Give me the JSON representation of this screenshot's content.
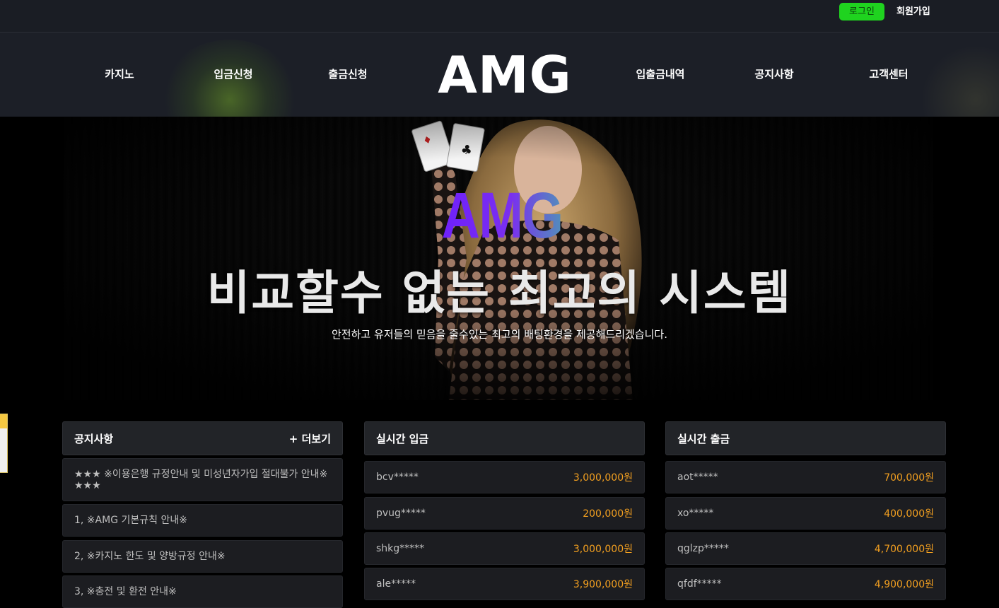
{
  "topbar": {
    "login_label": "로그인",
    "signup_label": "회원가입"
  },
  "nav": {
    "logo": "AMG",
    "items": [
      "카지노",
      "입금신청",
      "출금신청",
      "입출금내역",
      "공지사항",
      "고객센터"
    ]
  },
  "hero": {
    "logo": "AMG",
    "title": "비교할수 없는 최고의 시스템",
    "subtitle": "안전하고 유저들의 믿음을 줄수있는 최고의 배팅환경을 제공해드리겠습니다."
  },
  "notice": {
    "title": "공지사항",
    "more": "+ 더보기",
    "items": [
      "★★★ ※이용은행 규정안내 및 미성년자가입 절대불가 안내※ ★★★",
      "1, ※AMG 기본규칙 안내※",
      "2, ※카지노 한도 및 양방규정 안내※",
      "3, ※충전 및 환전 안내※"
    ]
  },
  "deposit": {
    "title": "실시간 입금",
    "rows": [
      {
        "user": "bcv*****",
        "amount": "3,000,000원"
      },
      {
        "user": "pvug*****",
        "amount": "200,000원"
      },
      {
        "user": "shkg*****",
        "amount": "3,000,000원"
      },
      {
        "user": "ale*****",
        "amount": "3,900,000원"
      }
    ]
  },
  "withdraw": {
    "title": "실시간 출금",
    "rows": [
      {
        "user": "aot*****",
        "amount": "700,000원"
      },
      {
        "user": "xo*****",
        "amount": "400,000원"
      },
      {
        "user": "qglzp*****",
        "amount": "4,700,000원"
      },
      {
        "user": "qfdf*****",
        "amount": "4,900,000원"
      }
    ]
  },
  "colors": {
    "login_bg": "#1fd31f",
    "amount": "#f3a020",
    "panel": "#222428",
    "row": "#1c1d21"
  }
}
